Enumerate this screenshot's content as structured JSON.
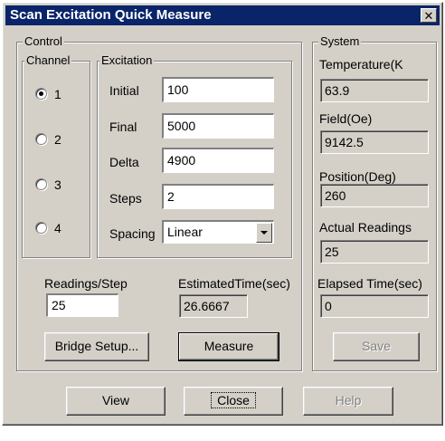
{
  "window": {
    "title": "Scan Excitation Quick Measure",
    "close_glyph": "✕"
  },
  "control": {
    "legend": "Control",
    "channel": {
      "legend": "Channel",
      "options": [
        "1",
        "2",
        "3",
        "4"
      ],
      "selected": "1"
    },
    "excitation": {
      "legend": "Excitation",
      "initial_label": "Initial",
      "initial_value": "100",
      "final_label": "Final",
      "final_value": "5000",
      "delta_label": "Delta",
      "delta_value": "4900",
      "steps_label": "Steps",
      "steps_value": "2",
      "spacing_label": "Spacing",
      "spacing_value": "Linear"
    },
    "readings_label": "Readings/Step",
    "readings_value": "25",
    "estimated_label": "EstimatedTime(sec)",
    "estimated_value": "26.6667",
    "bridge_button": "Bridge Setup...",
    "measure_button": "Measure"
  },
  "system": {
    "legend": "System",
    "temperature_label": "Temperature(K",
    "temperature_value": "63.9",
    "field_label": "Field(Oe)",
    "field_value": "9142.5",
    "position_label": "Position(Deg)",
    "position_value": "260",
    "actual_label": "Actual Readings",
    "actual_value": "25",
    "elapsed_label": "Elapsed Time(sec)",
    "elapsed_value": "0",
    "save_button": "Save"
  },
  "footer": {
    "view_button": "View",
    "close_button": "Close",
    "help_button": "Help"
  }
}
